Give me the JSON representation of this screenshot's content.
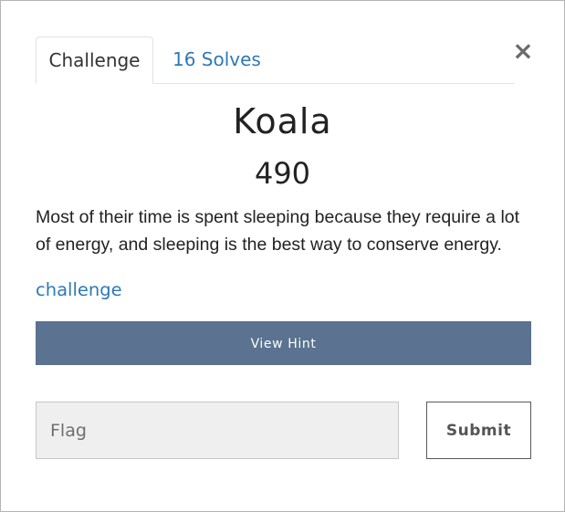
{
  "tabs": [
    {
      "label": "Challenge",
      "active": true
    },
    {
      "label": "16 Solves",
      "active": false
    }
  ],
  "close_glyph": "×",
  "challenge": {
    "name": "Koala",
    "points": "490",
    "description": "Most of their time is spent sleeping because they require a lot of energy, and sleeping is the best way to conserve energy.",
    "file_link": "challenge"
  },
  "hint_button": {
    "label": "View Hint"
  },
  "flag": {
    "placeholder": "Flag",
    "value": ""
  },
  "submit_button": {
    "label": "Submit"
  },
  "colors": {
    "link": "#2f79b5",
    "hint_button_bg": "#5b7290",
    "input_bg": "#efefef"
  }
}
